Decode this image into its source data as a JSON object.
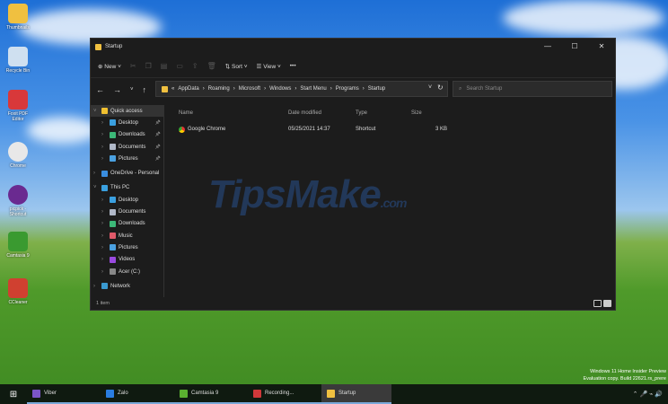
{
  "desktop": {
    "icons": [
      "Thumbnails",
      "Recycle Bin",
      "Foxit PDF Editor",
      "Chrome",
      "picpick - Shortcut",
      "Camtasia 9",
      "CCleaner"
    ]
  },
  "window": {
    "title": "Startup",
    "controls": [
      "—",
      "☐",
      "✕"
    ]
  },
  "command_bar": {
    "new": "New",
    "sort": "Sort",
    "view": "View",
    "more": "•••"
  },
  "address": {
    "crumbs": [
      "«",
      "AppData",
      "Roaming",
      "Microsoft",
      "Windows",
      "Start Menu",
      "Programs",
      "Startup"
    ],
    "search_placeholder": "Search Startup"
  },
  "sidebar": {
    "items": [
      {
        "label": "Quick access",
        "color": "#f0c030",
        "level": 0,
        "expanded": true
      },
      {
        "label": "Desktop",
        "color": "#3aa0e0",
        "level": 1,
        "pin": true
      },
      {
        "label": "Downloads",
        "color": "#3cb878",
        "level": 1,
        "pin": true
      },
      {
        "label": "Documents",
        "color": "#b0b8c8",
        "level": 1,
        "pin": true
      },
      {
        "label": "Pictures",
        "color": "#4aa0e0",
        "level": 1,
        "pin": true
      },
      {
        "label": "OneDrive - Personal",
        "color": "#3a8ee0",
        "level": 0
      },
      {
        "label": "This PC",
        "color": "#3aa0e0",
        "level": 0,
        "expanded": true
      },
      {
        "label": "Desktop",
        "color": "#3aa0e0",
        "level": 1
      },
      {
        "label": "Documents",
        "color": "#b0b8c8",
        "level": 1
      },
      {
        "label": "Downloads",
        "color": "#3cb878",
        "level": 1
      },
      {
        "label": "Music",
        "color": "#e05a6a",
        "level": 1
      },
      {
        "label": "Pictures",
        "color": "#4aa0e0",
        "level": 1
      },
      {
        "label": "Videos",
        "color": "#9a4ae0",
        "level": 1
      },
      {
        "label": "Acer (C:)",
        "color": "#888888",
        "level": 1
      },
      {
        "label": "Network",
        "color": "#3a9ad0",
        "level": 0
      }
    ]
  },
  "table": {
    "headers": [
      "Name",
      "Date modified",
      "Type",
      "Size"
    ],
    "rows": [
      {
        "name": "Google Chrome",
        "date": "05/25/2021 14:37",
        "type": "Shortcut",
        "size": "3 KB"
      }
    ]
  },
  "status": {
    "count": "1 item"
  },
  "watermark": {
    "text": "TipsMake",
    ".com": ".com"
  },
  "taskbar": {
    "items": [
      {
        "label": "Viber",
        "color": "#7b55c8"
      },
      {
        "label": "Zalo",
        "color": "#2a7de0"
      },
      {
        "label": "Camtasia 9",
        "color": "#5ab030"
      },
      {
        "label": "Recording...",
        "color": "#d0383a"
      },
      {
        "label": "Startup",
        "color": "#f0c040"
      }
    ]
  },
  "os_watermark": {
    "line1": "Windows 11 Home Insider Preview",
    "line2": "Evaluation copy. Build 22621.rs_prere"
  }
}
